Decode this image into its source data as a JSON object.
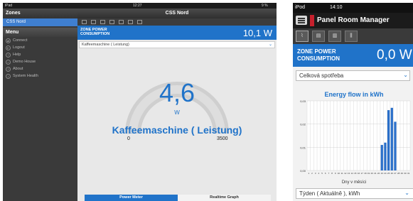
{
  "tablet": {
    "status": {
      "carrier": "iPad",
      "time": "12:27",
      "battery": "9 %"
    },
    "sidebar": {
      "title": "Zones",
      "selected_zone": "CSS Nord",
      "menu_title": "Menu",
      "items": [
        {
          "label": "Connect",
          "icon": "connect-icon"
        },
        {
          "label": "Logout",
          "icon": "logout-icon"
        },
        {
          "label": "Help",
          "icon": "help-icon"
        },
        {
          "label": "Demo House",
          "icon": "house-icon"
        },
        {
          "label": "About",
          "icon": "about-icon"
        },
        {
          "label": "System Health",
          "icon": "health-icon"
        }
      ]
    },
    "main": {
      "title": "CSS Nord",
      "zone_label_line1": "ZONE POWER",
      "zone_label_line2": "CONSUMPTION",
      "zone_value": "10,1 W",
      "device_select": "Kaffeemaschine ( Leistung)",
      "gauge": {
        "value": "4,6",
        "value_num": 4.6,
        "min": "0",
        "max": "3500",
        "max_num": 3500,
        "unit": "W"
      },
      "device_name": "Kaffeemaschine ( Leistung)",
      "tabs": [
        "Power Meter",
        "Realtime Graph"
      ],
      "accent": "#2073c9"
    }
  },
  "phone": {
    "status": {
      "carrier": "iPod",
      "time": "14:10"
    },
    "title": "Panel Room Manager",
    "zone_label_line1": "ZONE POWER",
    "zone_label_line2": "CONSUMPTION",
    "zone_value": "0,0 W",
    "select_top": "Celková spotřeba",
    "period_select": "Týden ( Aktuálně ), kWh",
    "chart_data": {
      "type": "bar",
      "title": "Energy flow in kWh",
      "xlabel": "Dny v měsíci",
      "ylabel": "",
      "ylim": [
        0,
        0.03
      ],
      "yticks": [
        "0,00",
        "0,01",
        "0,02",
        "0,03"
      ],
      "categories": [
        "1",
        "2",
        "3",
        "4",
        "5",
        "6",
        "7",
        "8",
        "9",
        "10",
        "11",
        "12",
        "13",
        "14",
        "15",
        "16",
        "17",
        "18",
        "19",
        "20",
        "21",
        "22",
        "23",
        "24",
        "25",
        "26",
        "27",
        "28",
        "29",
        "30",
        "31"
      ],
      "values": [
        0,
        0,
        0,
        0,
        0,
        0,
        0,
        0,
        0,
        0,
        0,
        0,
        0,
        0,
        0,
        0,
        0,
        0,
        0,
        0,
        0,
        0,
        0.011,
        0.012,
        0.026,
        0.027,
        0.021,
        0,
        0,
        0,
        0
      ],
      "grid": true,
      "color": "#2a6fc9"
    }
  }
}
